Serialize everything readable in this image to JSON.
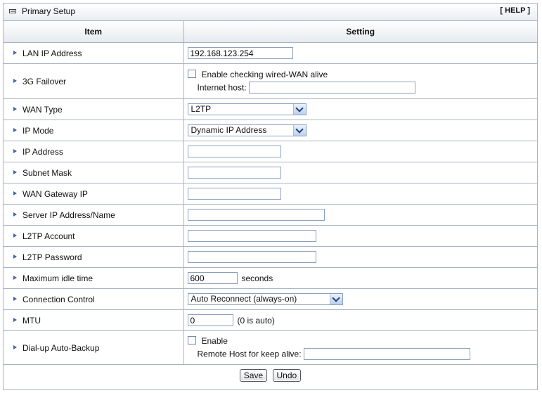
{
  "panel": {
    "title": "Primary Setup",
    "help": "[ HELP ]"
  },
  "table": {
    "col_item": "Item",
    "col_setting": "Setting"
  },
  "rows": {
    "lan_ip": {
      "label": "LAN IP Address",
      "value": "192.168.123.254"
    },
    "failover": {
      "label": "3G Failover",
      "checkbox_label": "Enable checking wired-WAN alive",
      "checked": false,
      "host_label": "Internet host:",
      "host_value": ""
    },
    "wan_type": {
      "label": "WAN Type",
      "selected": "L2TP"
    },
    "ip_mode": {
      "label": "IP Mode",
      "selected": "Dynamic IP Address"
    },
    "ip_address": {
      "label": "IP Address",
      "value": ""
    },
    "subnet_mask": {
      "label": "Subnet Mask",
      "value": ""
    },
    "gateway": {
      "label": "WAN Gateway IP",
      "value": ""
    },
    "server": {
      "label": "Server IP Address/Name",
      "value": ""
    },
    "account": {
      "label": "L2TP Account",
      "value": ""
    },
    "password": {
      "label": "L2TP Password",
      "value": ""
    },
    "idle": {
      "label": "Maximum idle time",
      "value": "600",
      "unit": "seconds"
    },
    "conn_control": {
      "label": "Connection Control",
      "selected": "Auto Reconnect (always-on)"
    },
    "mtu": {
      "label": "MTU",
      "value": "0",
      "note": "(0 is auto)"
    },
    "backup": {
      "label": "Dial-up Auto-Backup",
      "checkbox_label": "Enable",
      "checked": false,
      "remote_label": "Remote Host for keep alive:",
      "remote_value": ""
    }
  },
  "buttons": {
    "save": "Save",
    "undo": "Undo"
  },
  "colors": {
    "border": "#a9b4c3",
    "arrow": "#3a67a8",
    "select_button": "#bcd0ec"
  }
}
